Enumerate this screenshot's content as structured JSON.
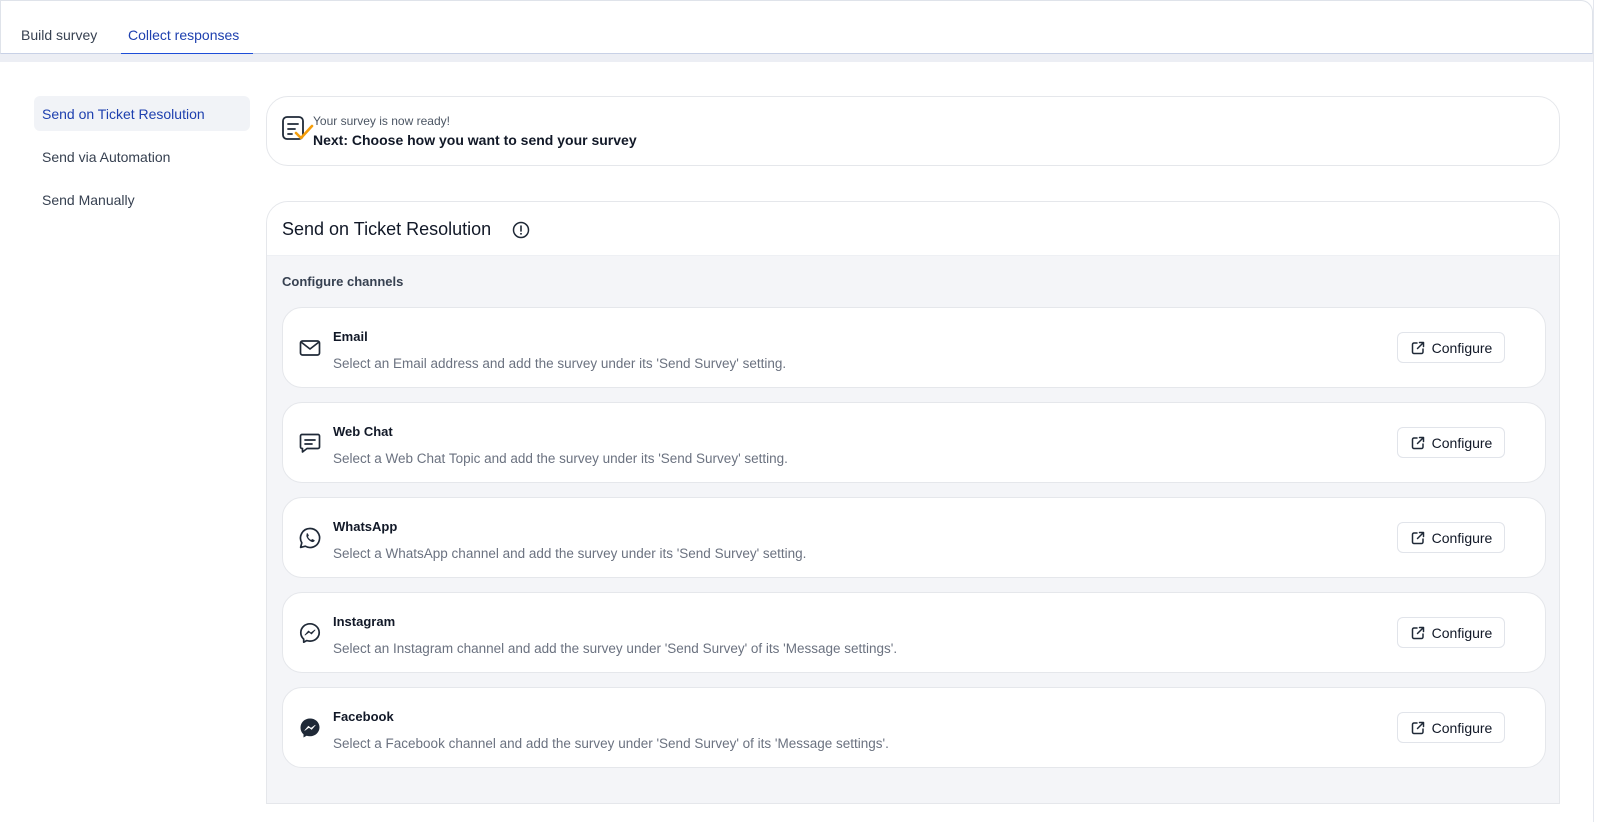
{
  "tabs": [
    {
      "label": "Build survey",
      "active": false
    },
    {
      "label": "Collect responses",
      "active": true
    }
  ],
  "sidebar": {
    "items": [
      {
        "label": "Send on Ticket Resolution",
        "active": true
      },
      {
        "label": "Send via Automation",
        "active": false
      },
      {
        "label": "Send Manually",
        "active": false
      }
    ]
  },
  "banner": {
    "subtitle": "Your survey is now ready!",
    "title": "Next: Choose how you want to send your survey",
    "icon": "survey-check-icon"
  },
  "section": {
    "title": "Send on Ticket Resolution",
    "info_icon": "info-icon",
    "configure_label": "Configure channels"
  },
  "channels": [
    {
      "name": "Email",
      "icon": "mail-icon",
      "description": "Select an Email address and add the survey under its 'Send Survey' setting.",
      "button": "Configure"
    },
    {
      "name": "Web Chat",
      "icon": "chat-icon",
      "description": "Select a Web Chat Topic and add the survey under its 'Send Survey' setting.",
      "button": "Configure"
    },
    {
      "name": "WhatsApp",
      "icon": "whatsapp-icon",
      "description": "Select a WhatsApp channel and add the survey under its 'Send Survey' setting.",
      "button": "Configure"
    },
    {
      "name": "Instagram",
      "icon": "messenger-icon",
      "description": "Select an Instagram channel and add the survey under 'Send Survey' of its 'Message settings'.",
      "button": "Configure"
    },
    {
      "name": "Facebook",
      "icon": "messenger-filled-icon",
      "description": "Select a Facebook channel and add the survey under 'Send Survey' of its 'Message settings'.",
      "button": "Configure"
    }
  ],
  "colors": {
    "accent": "#1d4ed8",
    "active_text": "#1e40af",
    "check_orange": "#f59e0b",
    "panel_bg": "#f4f5f8"
  }
}
